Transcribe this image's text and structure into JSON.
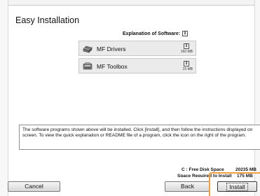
{
  "window": {
    "title": "Easy Installation"
  },
  "explanation": {
    "label": "Explanation of Software:",
    "icon": "info-icon"
  },
  "software": [
    {
      "name": "MF Drivers",
      "size": "160 MB",
      "icon": "printer-driver-icon"
    },
    {
      "name": "MF Toolbox",
      "size": "15 MB",
      "icon": "toolbox-printer-icon"
    }
  ],
  "description": "The software programs shown above will be installed. Click [Install], and then follow the instructions displayed on screen. To view the quick explanation or README file of a program, click the icon on the right of the program.",
  "disk": {
    "free_label": "C : Free Disk Space",
    "free_value": "20235 MB",
    "required_label": "Space Required to Install",
    "required_value": "175 MB"
  },
  "buttons": {
    "cancel": "Cancel",
    "back": "Back",
    "install": "Install"
  },
  "colors": {
    "highlight": "#f0a040",
    "item_bg": "#ebebeb"
  }
}
